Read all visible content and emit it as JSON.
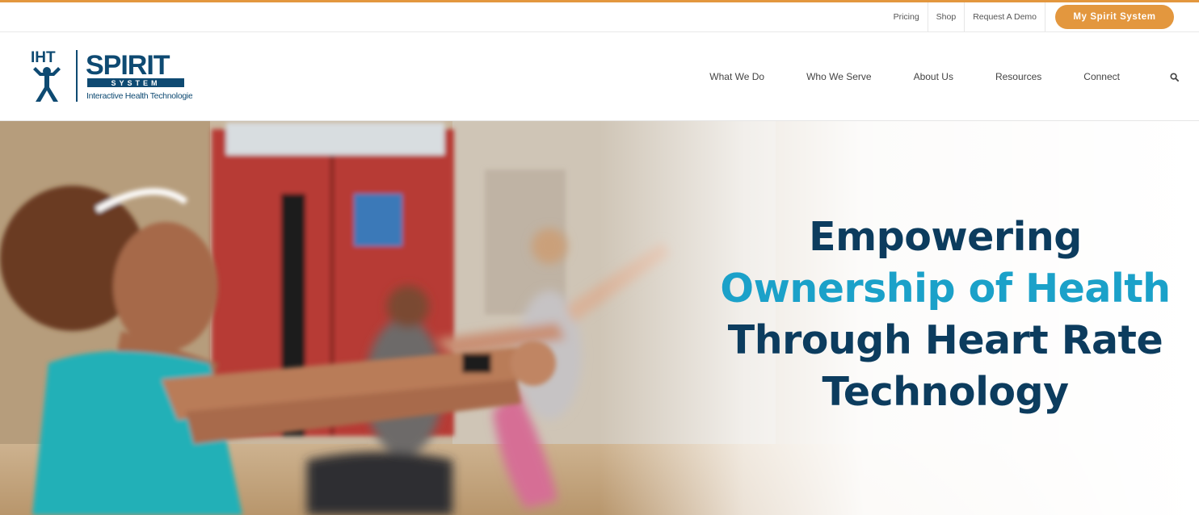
{
  "topbar": {
    "links": [
      "Pricing",
      "Shop",
      "Request A Demo"
    ],
    "cta_label": "My Spirit System"
  },
  "logo": {
    "mark": "IHT",
    "wordmark": "SPIRIT",
    "subword": "SYSTEM",
    "tagline": "Interactive Health Technologies"
  },
  "nav": {
    "items": [
      "What We Do",
      "Who We Serve",
      "About Us",
      "Resources",
      "Connect"
    ],
    "search_icon": "search-icon"
  },
  "hero": {
    "line1": "Empowering",
    "line2": "Ownership of Health",
    "line3": "Through Heart Rate",
    "line4": "Technology"
  },
  "colors": {
    "accent_orange": "#e3973e",
    "navy": "#0c3c5e",
    "teal": "#1ba1c9",
    "logo_blue": "#0e4a72"
  }
}
